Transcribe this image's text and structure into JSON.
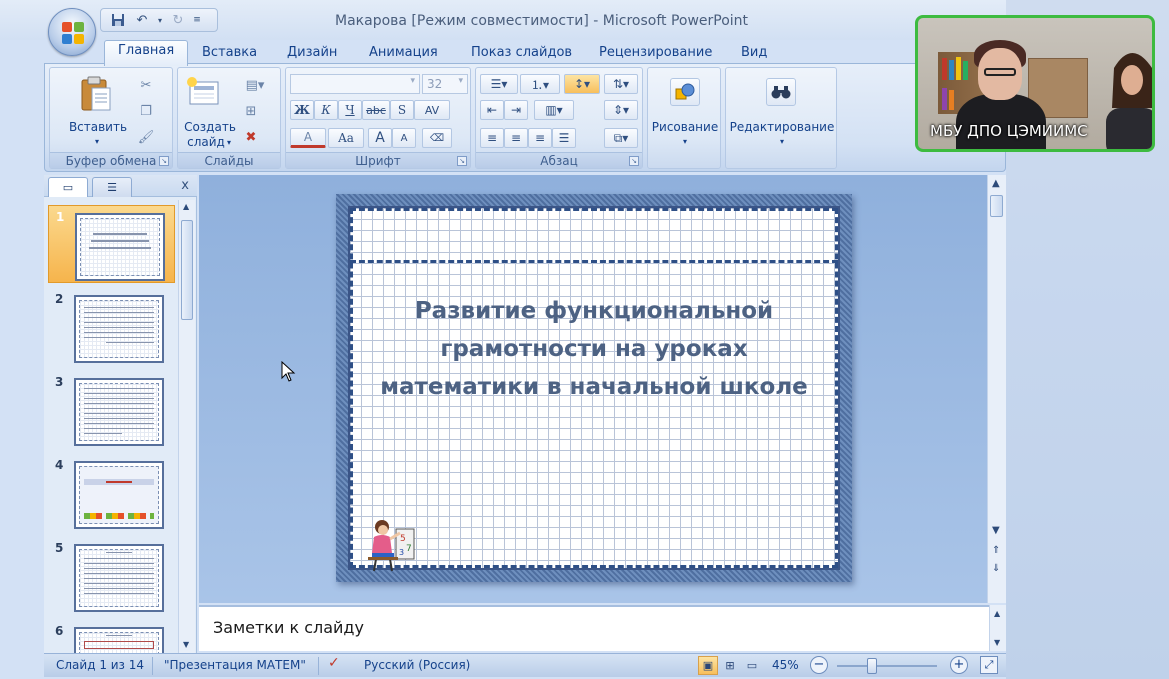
{
  "window": {
    "title": "Макарова [Режим совместимости] - Microsoft PowerPoint"
  },
  "tabs": [
    {
      "label": "Главная",
      "active": true
    },
    {
      "label": "Вставка"
    },
    {
      "label": "Дизайн"
    },
    {
      "label": "Анимация"
    },
    {
      "label": "Показ слайдов"
    },
    {
      "label": "Рецензирование"
    },
    {
      "label": "Вид"
    }
  ],
  "ribbon": {
    "clipboard": {
      "paste_label": "Вставить",
      "group_label": "Буфер обмена"
    },
    "slides": {
      "create_label_1": "Создать",
      "create_label_2": "слайд",
      "group_label": "Слайды"
    },
    "font": {
      "font_name": "",
      "font_size": "32",
      "bold": "Ж",
      "italic": "К",
      "underline": "Ч",
      "strike": "abc",
      "shadow": "S",
      "spacing": "AV",
      "color": "A",
      "case": "Aa",
      "grow": "A",
      "shrink": "A",
      "group_label": "Шрифт"
    },
    "paragraph": {
      "group_label": "Абзац"
    },
    "drawing": {
      "label": "Рисование"
    },
    "editing": {
      "label": "Редактирование"
    }
  },
  "slides_panel": {
    "close": "x",
    "thumbnails": [
      {
        "number": "1",
        "selected": true
      },
      {
        "number": "2"
      },
      {
        "number": "3"
      },
      {
        "number": "4"
      },
      {
        "number": "5"
      },
      {
        "number": "6"
      }
    ]
  },
  "slide": {
    "title_line1": "Развитие функциональной",
    "title_line2": "грамотности на уроках",
    "title_line3": "математики в начальной школе"
  },
  "notes": {
    "placeholder": "Заметки к слайду"
  },
  "status": {
    "slide_position": "Слайд 1 из 14",
    "theme": "\"Презентация МАТЕМ\"",
    "language": "Русский (Россия)",
    "zoom": "45%",
    "zoom_fraction": 0.35
  },
  "webcam": {
    "label": "МБУ ДПО ЦЭМИИМС"
  },
  "colors": {
    "accent": "#15428b",
    "selection": "#f6b44c",
    "webcam_border": "#3dbb40"
  }
}
